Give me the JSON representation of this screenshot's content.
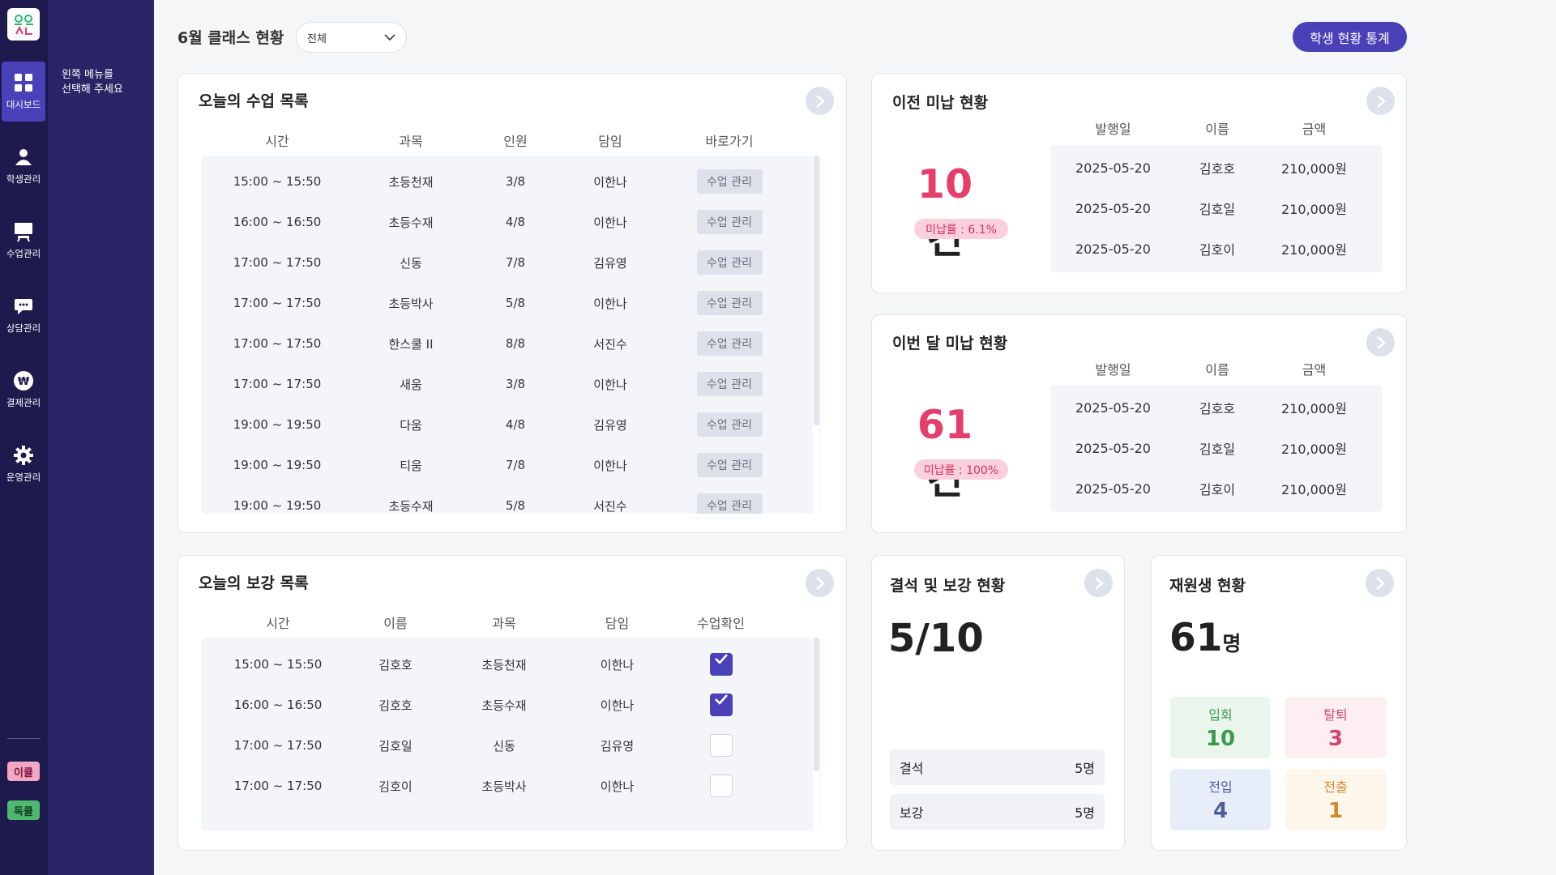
{
  "nav": {
    "logo": "ㅎㅎ\nㅅㄴ",
    "items": [
      {
        "label": "대시보드",
        "icon": "dashboard-icon"
      },
      {
        "label": "학생관리",
        "icon": "student-icon"
      },
      {
        "label": "수업관리",
        "icon": "class-icon"
      },
      {
        "label": "상담관리",
        "icon": "consult-icon"
      },
      {
        "label": "결제관리",
        "icon": "payment-icon"
      },
      {
        "label": "운영관리",
        "icon": "gear-icon"
      }
    ],
    "tags": [
      "이큘",
      "독큘"
    ],
    "hint_line1": "왼쪽 메뉴를",
    "hint_line2": "선택해 주세요"
  },
  "header": {
    "title": "6월 클래스 현황",
    "filter_value": "전체",
    "stats_button": "학생 현황 통계"
  },
  "today_classes": {
    "title": "오늘의 수업 목록",
    "columns": [
      "시간",
      "과목",
      "인원",
      "담임",
      "바로가기"
    ],
    "button_label": "수업 관리",
    "rows": [
      [
        "15:00 ~ 15:50",
        "초등천재",
        "3/8",
        "이한나"
      ],
      [
        "16:00 ~ 16:50",
        "초등수재",
        "4/8",
        "이한나"
      ],
      [
        "17:00 ~ 17:50",
        "신동",
        "7/8",
        "김유영"
      ],
      [
        "17:00 ~ 17:50",
        "초등박사",
        "5/8",
        "이한나"
      ],
      [
        "17:00 ~ 17:50",
        "한스쿨 II",
        "8/8",
        "서진수"
      ],
      [
        "17:00 ~ 17:50",
        "새움",
        "3/8",
        "이한나"
      ],
      [
        "19:00 ~ 19:50",
        "다움",
        "4/8",
        "김유영"
      ],
      [
        "19:00 ~ 19:50",
        "티움",
        "7/8",
        "이한나"
      ],
      [
        "19:00 ~ 19:50",
        "초등수재",
        "5/8",
        "서진수"
      ]
    ]
  },
  "prev_unpaid": {
    "title": "이전 미납 현황",
    "count": "10",
    "unit": "건",
    "rate": "미납률 : 6.1%",
    "columns": [
      "발행일",
      "이름",
      "금액"
    ],
    "rows": [
      [
        "2025-05-20",
        "김호호",
        "210,000원"
      ],
      [
        "2025-05-20",
        "김호일",
        "210,000원"
      ],
      [
        "2025-05-20",
        "김호이",
        "210,000원"
      ]
    ]
  },
  "this_unpaid": {
    "title": "이번 달 미납 현황",
    "count": "61",
    "unit": "건",
    "rate": "미납률 : 100%",
    "columns": [
      "발행일",
      "이름",
      "금액"
    ],
    "rows": [
      [
        "2025-05-20",
        "김호호",
        "210,000원"
      ],
      [
        "2025-05-20",
        "김호일",
        "210,000원"
      ],
      [
        "2025-05-20",
        "김호이",
        "210,000원"
      ]
    ]
  },
  "makeup_classes": {
    "title": "오늘의 보강 목록",
    "columns": [
      "시간",
      "이름",
      "과목",
      "담임",
      "수업확인"
    ],
    "rows": [
      {
        "cells": [
          "15:00 ~ 15:50",
          "김호호",
          "초등천재",
          "이한나"
        ],
        "checked": true
      },
      {
        "cells": [
          "16:00 ~ 16:50",
          "김호호",
          "초등수재",
          "이한나"
        ],
        "checked": true
      },
      {
        "cells": [
          "17:00 ~ 17:50",
          "김호일",
          "신동",
          "김유영"
        ],
        "checked": false
      },
      {
        "cells": [
          "17:00 ~ 17:50",
          "김호이",
          "초등박사",
          "이한나"
        ],
        "checked": false
      }
    ]
  },
  "absence": {
    "title": "결석 및 보강 현황",
    "ratio": "5/10",
    "rows": [
      {
        "label": "결석",
        "value": "5명"
      },
      {
        "label": "보강",
        "value": "5명"
      }
    ]
  },
  "enrollment": {
    "title": "재원생 현황",
    "count": "61",
    "unit": "명",
    "tiles": [
      {
        "label": "입회",
        "value": "10",
        "bg": "#eaf6ec",
        "fg": "#3a9a4c"
      },
      {
        "label": "탈퇴",
        "value": "3",
        "bg": "#fdeef2",
        "fg": "#d0476b"
      },
      {
        "label": "전입",
        "value": "4",
        "bg": "#e8eef9",
        "fg": "#4b5da0"
      },
      {
        "label": "전출",
        "value": "1",
        "bg": "#fdf6ea",
        "fg": "#d18a2c"
      }
    ]
  },
  "colors": {
    "sidebar": "#1e1a4d",
    "subpanel": "#2a2566",
    "accent": "#4a40b8",
    "alert": "#e53e6c"
  }
}
